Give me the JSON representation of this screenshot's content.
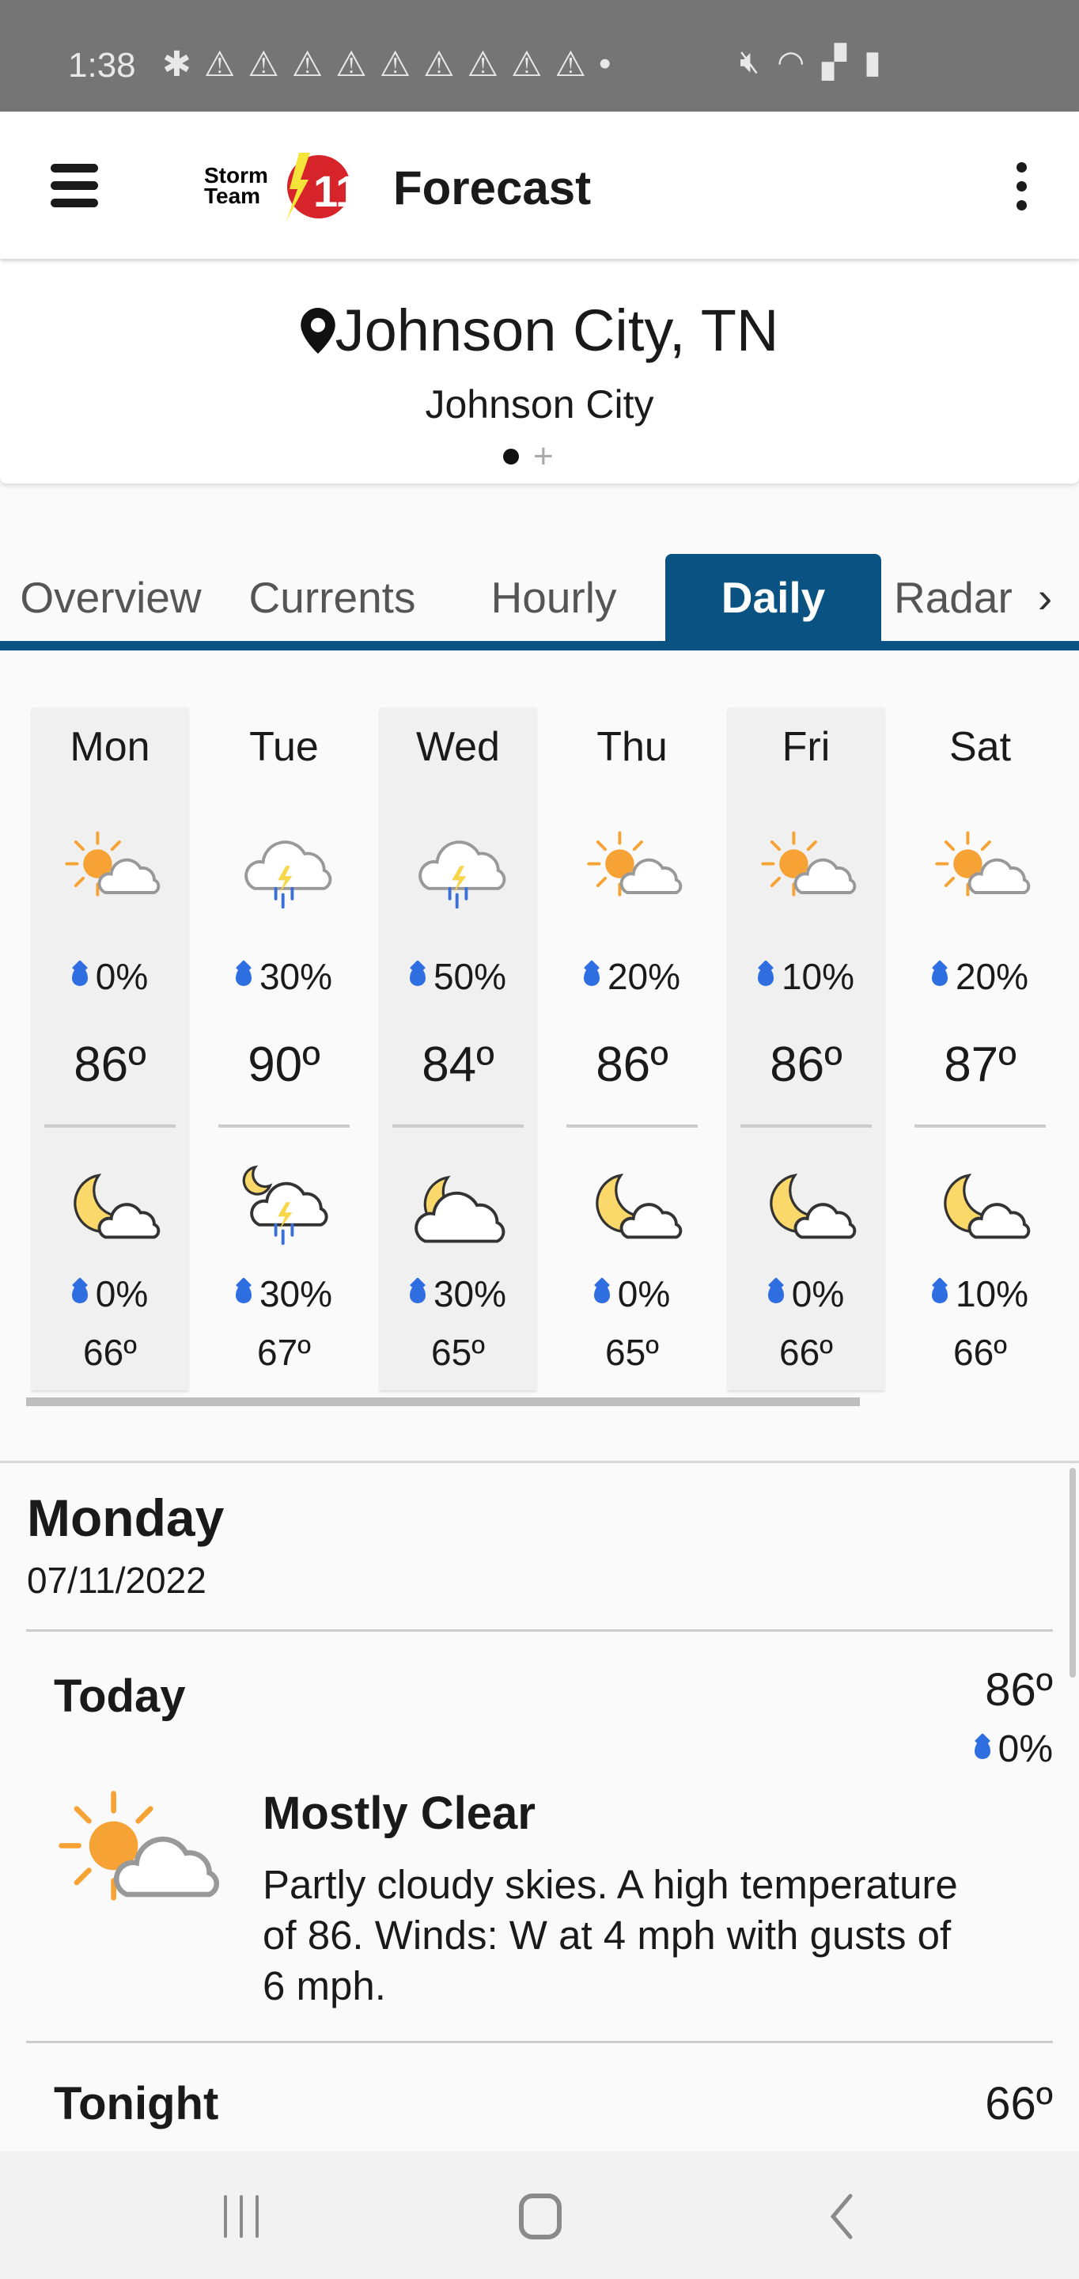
{
  "status_bar": {
    "time": "1:38",
    "notification_icons": [
      "slack-icon",
      "warning-icon",
      "warning-icon",
      "warning-icon",
      "warning-icon",
      "warning-icon",
      "warning-icon",
      "warning-icon",
      "warning-icon",
      "warning-icon",
      "dot-icon"
    ],
    "system_icons": [
      "mute-icon",
      "wifi-icon",
      "signal-icon",
      "battery-charging-icon"
    ]
  },
  "app_bar": {
    "logo_text": "Storm Team 11",
    "title": "Forecast"
  },
  "location": {
    "name": "Johnson City, TN",
    "subtitle": "Johnson City",
    "pages": 2,
    "current_page": 1
  },
  "tabs": [
    {
      "label": "Overview"
    },
    {
      "label": "Currents"
    },
    {
      "label": "Hourly"
    },
    {
      "label": "Daily",
      "active": true
    },
    {
      "label": "Radar"
    }
  ],
  "days": [
    {
      "name": "Mon",
      "day_icon": "partly-sunny",
      "day_precip": "0%",
      "high": "86º",
      "night_icon": "night-partly-cloudy",
      "night_precip": "0%",
      "low": "66º",
      "highlight": true
    },
    {
      "name": "Tue",
      "day_icon": "thunderstorm",
      "day_precip": "30%",
      "high": "90º",
      "night_icon": "night-thunderstorm",
      "night_precip": "30%",
      "low": "67º",
      "highlight": false
    },
    {
      "name": "Wed",
      "day_icon": "thunderstorm",
      "day_precip": "50%",
      "high": "84º",
      "night_icon": "night-mostly-cloudy",
      "night_precip": "30%",
      "low": "65º",
      "highlight": true
    },
    {
      "name": "Thu",
      "day_icon": "partly-sunny",
      "day_precip": "20%",
      "high": "86º",
      "night_icon": "night-partly-cloudy",
      "night_precip": "0%",
      "low": "65º",
      "highlight": false
    },
    {
      "name": "Fri",
      "day_icon": "partly-sunny",
      "day_precip": "10%",
      "high": "86º",
      "night_icon": "night-partly-cloudy",
      "night_precip": "0%",
      "low": "66º",
      "highlight": true
    },
    {
      "name": "Sat",
      "day_icon": "partly-sunny",
      "day_precip": "20%",
      "high": "87º",
      "night_icon": "night-partly-cloudy",
      "night_precip": "10%",
      "low": "66º",
      "highlight": false
    }
  ],
  "detail": {
    "day": "Monday",
    "date": "07/11/2022",
    "periods": [
      {
        "title": "Today",
        "temp": "86º",
        "precip": "0%",
        "icon": "partly-sunny",
        "condition": "Mostly Clear",
        "description": "Partly cloudy skies.  A high temperature of 86.  Winds: W at 4 mph with gusts of 6 mph."
      },
      {
        "title": "Tonight",
        "temp": "66º"
      }
    ]
  },
  "colors": {
    "accent": "#0a5282",
    "precip": "#2f6ee0",
    "sun": "#f7a234",
    "moon": "#fbd86a"
  }
}
